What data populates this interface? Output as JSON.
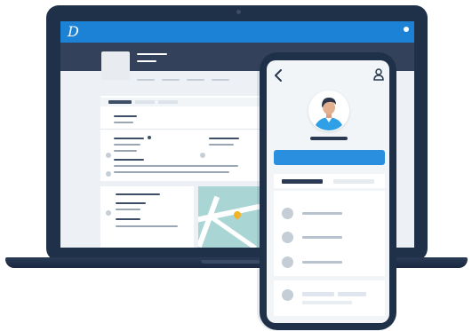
{
  "window": {
    "title": ""
  },
  "app": {
    "logo_text": "D"
  },
  "icons": {
    "logo": "brand-logo-icon",
    "back": "chevron-left-icon",
    "profile": "user-icon",
    "map_pin": "map-pin-icon"
  },
  "colors": {
    "brand_blue": "#1b82d6",
    "button_blue": "#2b8fe0",
    "device_navy": "#1f3149",
    "pin_yellow": "#f4b324",
    "map_teal": "#a9d5d4"
  }
}
